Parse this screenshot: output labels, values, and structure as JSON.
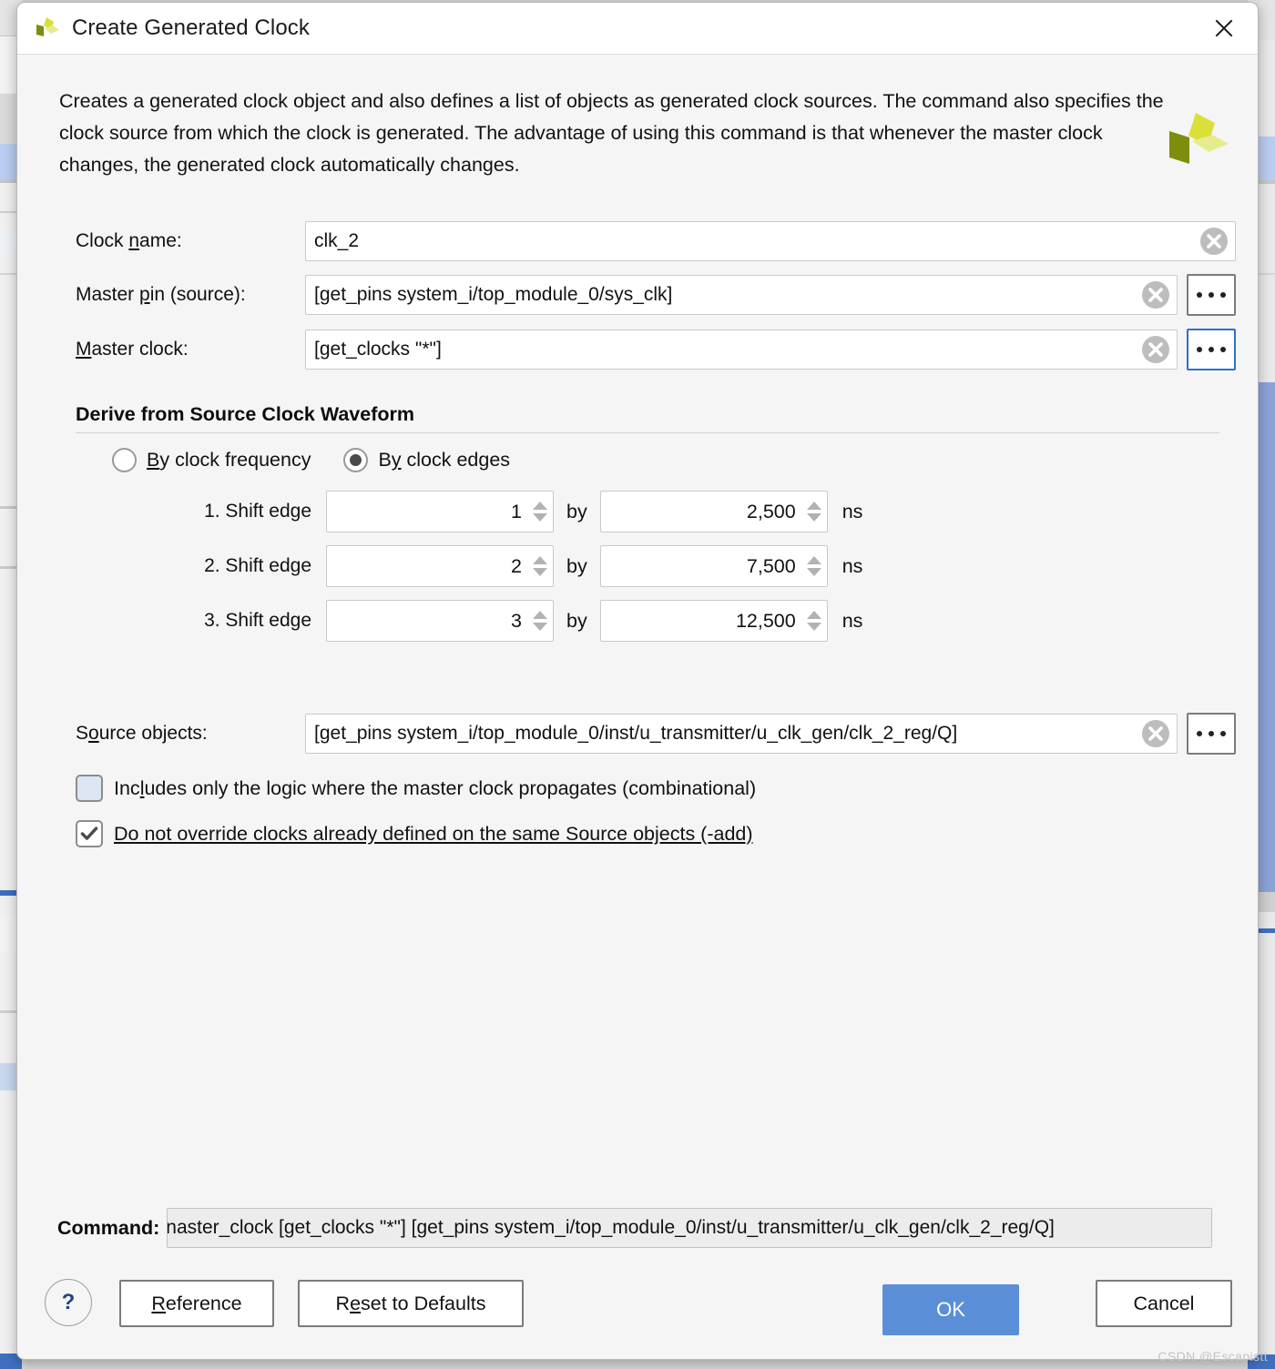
{
  "window": {
    "title": "Create Generated Clock",
    "logo_icon": "vivado-logo-icon",
    "close_icon": "close-icon"
  },
  "description": "Creates a generated clock object and also defines a list of objects as generated clock sources. The command also specifies the clock source from which the clock is generated. The advantage of using this command is that whenever the master clock changes, the generated clock automatically changes.",
  "fields": {
    "clock_name": {
      "label_pre": "Clock ",
      "label_mnemonic": "n",
      "label_post": "ame:",
      "value": "clk_2",
      "clear_icon": "clear-circle-icon"
    },
    "master_pin": {
      "label_pre": "Master ",
      "label_mnemonic": "p",
      "label_post": "in (source):",
      "value": "[get_pins system_i/top_module_0/sys_clk]",
      "clear_icon": "clear-circle-icon",
      "browse_label": "•••"
    },
    "master_clock": {
      "label_pre": "",
      "label_mnemonic": "M",
      "label_post": "aster clock:",
      "value": "[get_clocks  \"*\"]",
      "clear_icon": "clear-circle-icon",
      "browse_label": "•••"
    },
    "source_objects": {
      "label_pre": "S",
      "label_mnemonic": "o",
      "label_post": "urce objects:",
      "value": "[get_pins system_i/top_module_0/inst/u_transmitter/u_clk_gen/clk_2_reg/Q]",
      "clear_icon": "clear-circle-icon",
      "browse_label": "•••"
    }
  },
  "group": {
    "title": "Derive from Source Clock Waveform",
    "radios": [
      {
        "pre": "",
        "mnemonic": "B",
        "post": "y clock frequency",
        "selected": false
      },
      {
        "pre": "B",
        "mnemonic": "y",
        "post": " clock edges",
        "selected": true
      }
    ],
    "shift_edges": [
      {
        "label": "1. Shift edge",
        "edge": "1",
        "by_label": "by",
        "amount": "2,500",
        "unit": "ns"
      },
      {
        "label": "2. Shift edge",
        "edge": "2",
        "by_label": "by",
        "amount": "7,500",
        "unit": "ns"
      },
      {
        "label": "3. Shift edge",
        "edge": "3",
        "by_label": "by",
        "amount": "12,500",
        "unit": "ns"
      }
    ]
  },
  "checkboxes": [
    {
      "pre": "Inc",
      "mnemonic": "l",
      "post": "udes only the logic where the master clock propagates (combinational)",
      "checked": false,
      "underline_label": false
    },
    {
      "pre": "",
      "mnemonic": "D",
      "post": "o not override clocks already defined on the same Source objects (-add)",
      "checked": true,
      "underline_label": true,
      "check_icon": "checkmark-icon"
    }
  ],
  "command": {
    "label": "Command:",
    "text": "naster_clock [get_clocks  \"*\"] [get_pins system_i/top_module_0/inst/u_transmitter/u_clk_gen/clk_2_reg/Q]"
  },
  "buttons": {
    "help": "?",
    "reference": {
      "pre": "",
      "mnemonic": "R",
      "post": "eference"
    },
    "reset": {
      "pre": "R",
      "mnemonic": "e",
      "post": "set to Defaults"
    },
    "ok": "OK",
    "cancel": "Cancel"
  },
  "watermark": "CSDN @Escapistt",
  "colors": {
    "accent": "#5a8fd8",
    "dialog_bg": "#f5f5f5",
    "titlebar_bg": "#ffffff",
    "focus_border": "#2f6fd0",
    "logo_olive": "#7e8d0c",
    "logo_yellow": "#d9e03a",
    "logo_pale": "#e6ec8e"
  }
}
